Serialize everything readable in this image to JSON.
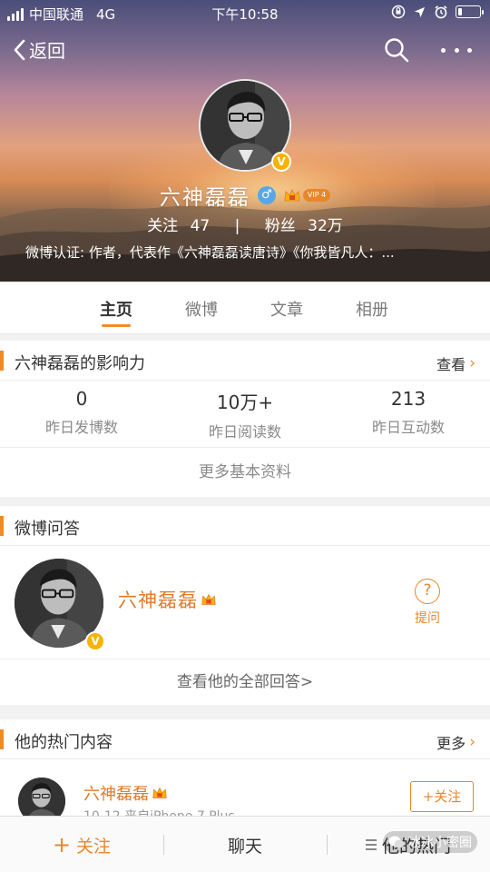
{
  "status_bar": {
    "carrier": "中国联通",
    "network": "4G",
    "time": "下午10:58",
    "battery_level": 0.2
  },
  "nav": {
    "back_label": "返回",
    "icons": [
      "chevron-left-icon",
      "search-icon",
      "more-icon"
    ]
  },
  "profile": {
    "name": "六神磊磊",
    "gender_symbol": "♂",
    "verified_badge": "V",
    "vip_label": "VIP 4",
    "following_label": "关注",
    "following_count": "47",
    "separator": "|",
    "followers_label": "粉丝",
    "followers_count": "32万",
    "verification": "微博认证: 作者，代表作《六神磊磊读唐诗》《你我皆凡人：..."
  },
  "tabs": [
    {
      "label": "主页",
      "active": true
    },
    {
      "label": "微博",
      "active": false
    },
    {
      "label": "文章",
      "active": false
    },
    {
      "label": "相册",
      "active": false
    }
  ],
  "influence": {
    "title": "六神磊磊的影响力",
    "link": "查看",
    "stats": [
      {
        "value": "0",
        "label": "昨日发博数"
      },
      {
        "value": "10万+",
        "label": "昨日阅读数"
      },
      {
        "value": "213",
        "label": "昨日互动数"
      }
    ],
    "more_info": "更多基本资料"
  },
  "qa": {
    "title": "微博问答",
    "name": "六神磊磊",
    "ask_icon": "?",
    "ask_label": "提问",
    "all_answers": "查看他的全部回答>"
  },
  "hot": {
    "title": "他的热门内容",
    "link": "更多",
    "item": {
      "name": "六神磊磊",
      "meta": "10-12 来自iPhone 7 Plus",
      "follow": "+关注"
    }
  },
  "bottom_bar": {
    "follow": "关注",
    "plus": "+",
    "chat": "聊天",
    "hot": "他的热门"
  },
  "watermark": "冰冰小密圈",
  "colors": {
    "accent": "#e8862b",
    "gold_badge": "#f6b400",
    "gender_blue": "#5aa7e6"
  }
}
